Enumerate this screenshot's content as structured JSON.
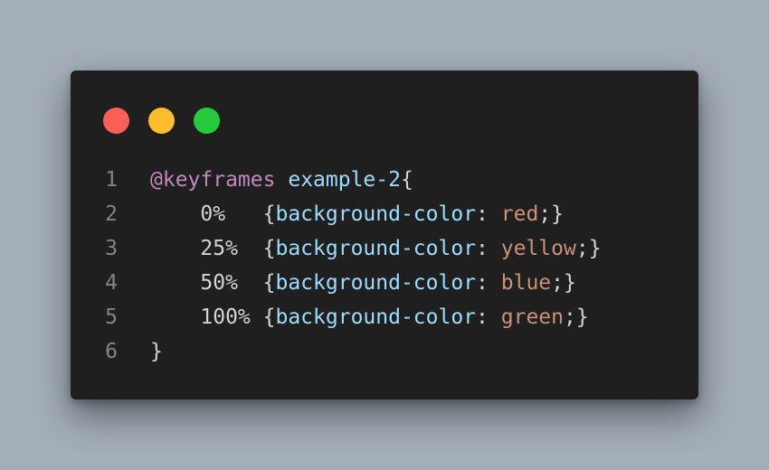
{
  "window": {
    "background": "#1f1f1f",
    "controls": [
      {
        "name": "close",
        "color": "#ff5f56"
      },
      {
        "name": "minimize",
        "color": "#ffbd2e"
      },
      {
        "name": "maximize",
        "color": "#27c93f"
      }
    ]
  },
  "code": {
    "lines": [
      {
        "number": "1",
        "tokens": [
          {
            "text": "@keyframes",
            "color": "#c586c0"
          },
          {
            "text": " ",
            "color": "#d4d4d4"
          },
          {
            "text": "example-2",
            "color": "#9cdcfe"
          },
          {
            "text": "{",
            "color": "#d4d4d4"
          }
        ]
      },
      {
        "number": "2",
        "tokens": [
          {
            "text": "    0%   ",
            "color": "#d4d4d4"
          },
          {
            "text": "{",
            "color": "#d4d4d4"
          },
          {
            "text": "background-color",
            "color": "#9cdcfe"
          },
          {
            "text": ": ",
            "color": "#d4d4d4"
          },
          {
            "text": "red",
            "color": "#ce9178"
          },
          {
            "text": ";}",
            "color": "#d4d4d4"
          }
        ]
      },
      {
        "number": "3",
        "tokens": [
          {
            "text": "    25%  ",
            "color": "#d4d4d4"
          },
          {
            "text": "{",
            "color": "#d4d4d4"
          },
          {
            "text": "background-color",
            "color": "#9cdcfe"
          },
          {
            "text": ": ",
            "color": "#d4d4d4"
          },
          {
            "text": "yellow",
            "color": "#ce9178"
          },
          {
            "text": ";}",
            "color": "#d4d4d4"
          }
        ]
      },
      {
        "number": "4",
        "tokens": [
          {
            "text": "    50%  ",
            "color": "#d4d4d4"
          },
          {
            "text": "{",
            "color": "#d4d4d4"
          },
          {
            "text": "background-color",
            "color": "#9cdcfe"
          },
          {
            "text": ": ",
            "color": "#d4d4d4"
          },
          {
            "text": "blue",
            "color": "#ce9178"
          },
          {
            "text": ";}",
            "color": "#d4d4d4"
          }
        ]
      },
      {
        "number": "5",
        "tokens": [
          {
            "text": "    100% ",
            "color": "#d4d4d4"
          },
          {
            "text": "{",
            "color": "#d4d4d4"
          },
          {
            "text": "background-color",
            "color": "#9cdcfe"
          },
          {
            "text": ": ",
            "color": "#d4d4d4"
          },
          {
            "text": "green",
            "color": "#ce9178"
          },
          {
            "text": ";}",
            "color": "#d4d4d4"
          }
        ]
      },
      {
        "number": "6",
        "tokens": [
          {
            "text": "}",
            "color": "#d4d4d4"
          }
        ]
      }
    ]
  }
}
